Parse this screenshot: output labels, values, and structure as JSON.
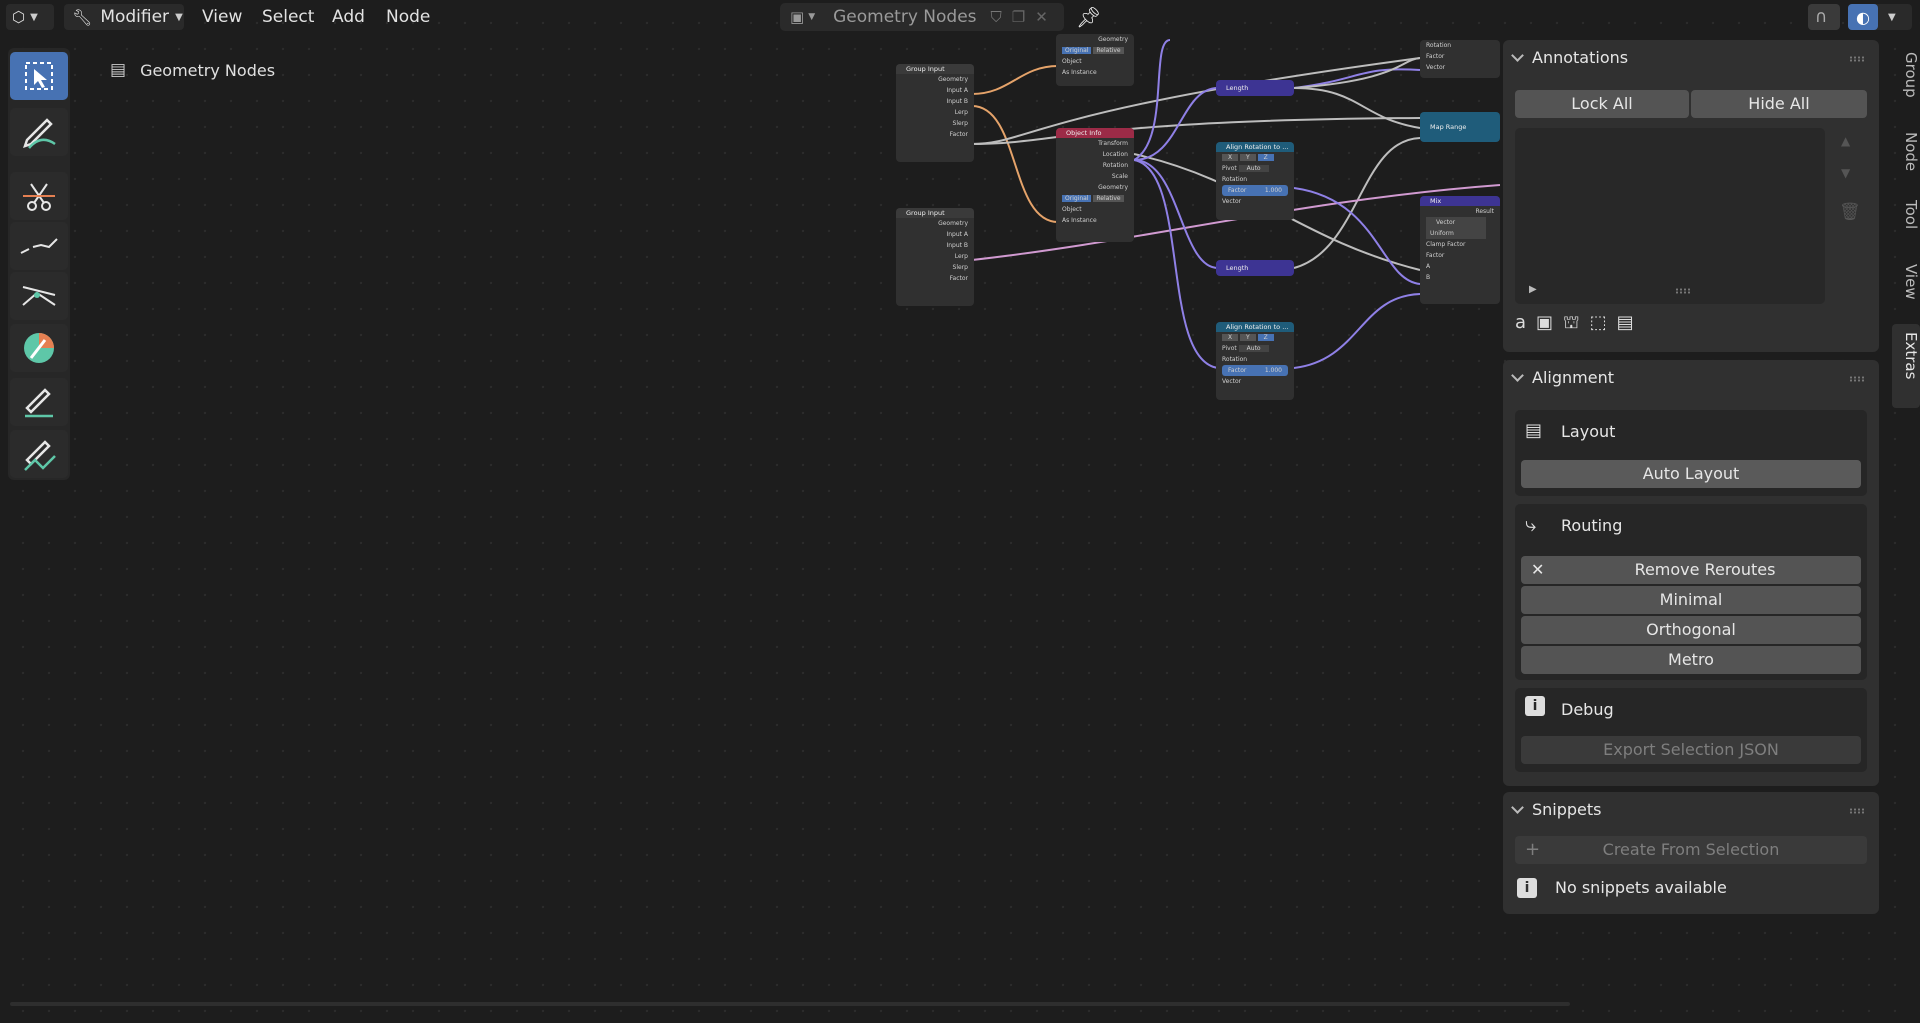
{
  "header": {
    "editor_mode": "Modifier",
    "menus": [
      "View",
      "Select",
      "Add",
      "Node"
    ],
    "tree_name": "Geometry Nodes"
  },
  "viewport": {
    "breadcrumb": "Geometry Nodes"
  },
  "nodes": {
    "group_input": {
      "title": "Group Input",
      "sockets": [
        "Geometry",
        "Input A",
        "Input B",
        "Lerp",
        "Slerp",
        "Factor"
      ]
    },
    "group_input2": {
      "title": "Group Input",
      "sockets": [
        "Geometry",
        "Input A",
        "Input B",
        "Lerp",
        "Slerp",
        "Factor"
      ]
    },
    "object_info_top": {
      "sockets": [
        "Geometry"
      ],
      "toggle": [
        "Original",
        "Relative"
      ],
      "object": "Object",
      "as_instance": "As Instance"
    },
    "object_info": {
      "title": "Object Info",
      "outputs": [
        "Transform",
        "Location",
        "Rotation",
        "Scale",
        "Geometry"
      ],
      "toggle": [
        "Original",
        "Relative"
      ],
      "object": "Object",
      "as_instance": "As Instance"
    },
    "length1": {
      "title": "Length"
    },
    "length2": {
      "title": "Length"
    },
    "align1": {
      "title": "Align Rotation to ...",
      "axes": [
        "X",
        "Y",
        "Z"
      ],
      "pivot": "Pivot",
      "pivot_val": "Auto",
      "rotation": "Rotation",
      "factor": "Factor",
      "factor_val": "1.000",
      "vector": "Vector"
    },
    "align2": {
      "title": "Align Rotation to ...",
      "axes": [
        "X",
        "Y",
        "Z"
      ],
      "pivot": "Pivot",
      "pivot_val": "Auto",
      "rotation": "Rotation",
      "factor": "Factor",
      "factor_val": "1.000",
      "vector": "Vector"
    },
    "top_right": {
      "sockets": [
        "Rotation",
        "Factor",
        "Vector"
      ]
    },
    "map_range": {
      "title": "Map Range"
    },
    "mix": {
      "title": "Mix",
      "result": "Result",
      "type": "Vector",
      "mode": "Uniform",
      "clamp": "Clamp Factor",
      "factor": "Factor",
      "a": "A",
      "b": "B"
    }
  },
  "sidebar": {
    "tabs": [
      "Group",
      "Node",
      "Tool",
      "View",
      "Extras"
    ],
    "annotations": {
      "title": "Annotations",
      "lock_all": "Lock All",
      "hide_all": "Hide All"
    },
    "alignment": {
      "title": "Alignment",
      "layout": {
        "title": "Layout",
        "auto_layout": "Auto Layout"
      },
      "routing": {
        "title": "Routing",
        "remove_reroutes": "Remove Reroutes",
        "minimal": "Minimal",
        "orthogonal": "Orthogonal",
        "metro": "Metro"
      },
      "debug": {
        "title": "Debug",
        "export": "Export Selection JSON"
      }
    },
    "snippets": {
      "title": "Snippets",
      "create": "Create From Selection",
      "empty": "No snippets available"
    }
  },
  "colors": {
    "accent": "#4772b3",
    "group_header": "#3a3a3a",
    "object_info_header": "#9c2b47",
    "vector_header": "#3d3493",
    "map_range_header": "#1f5c7a",
    "panel": "#303030"
  }
}
